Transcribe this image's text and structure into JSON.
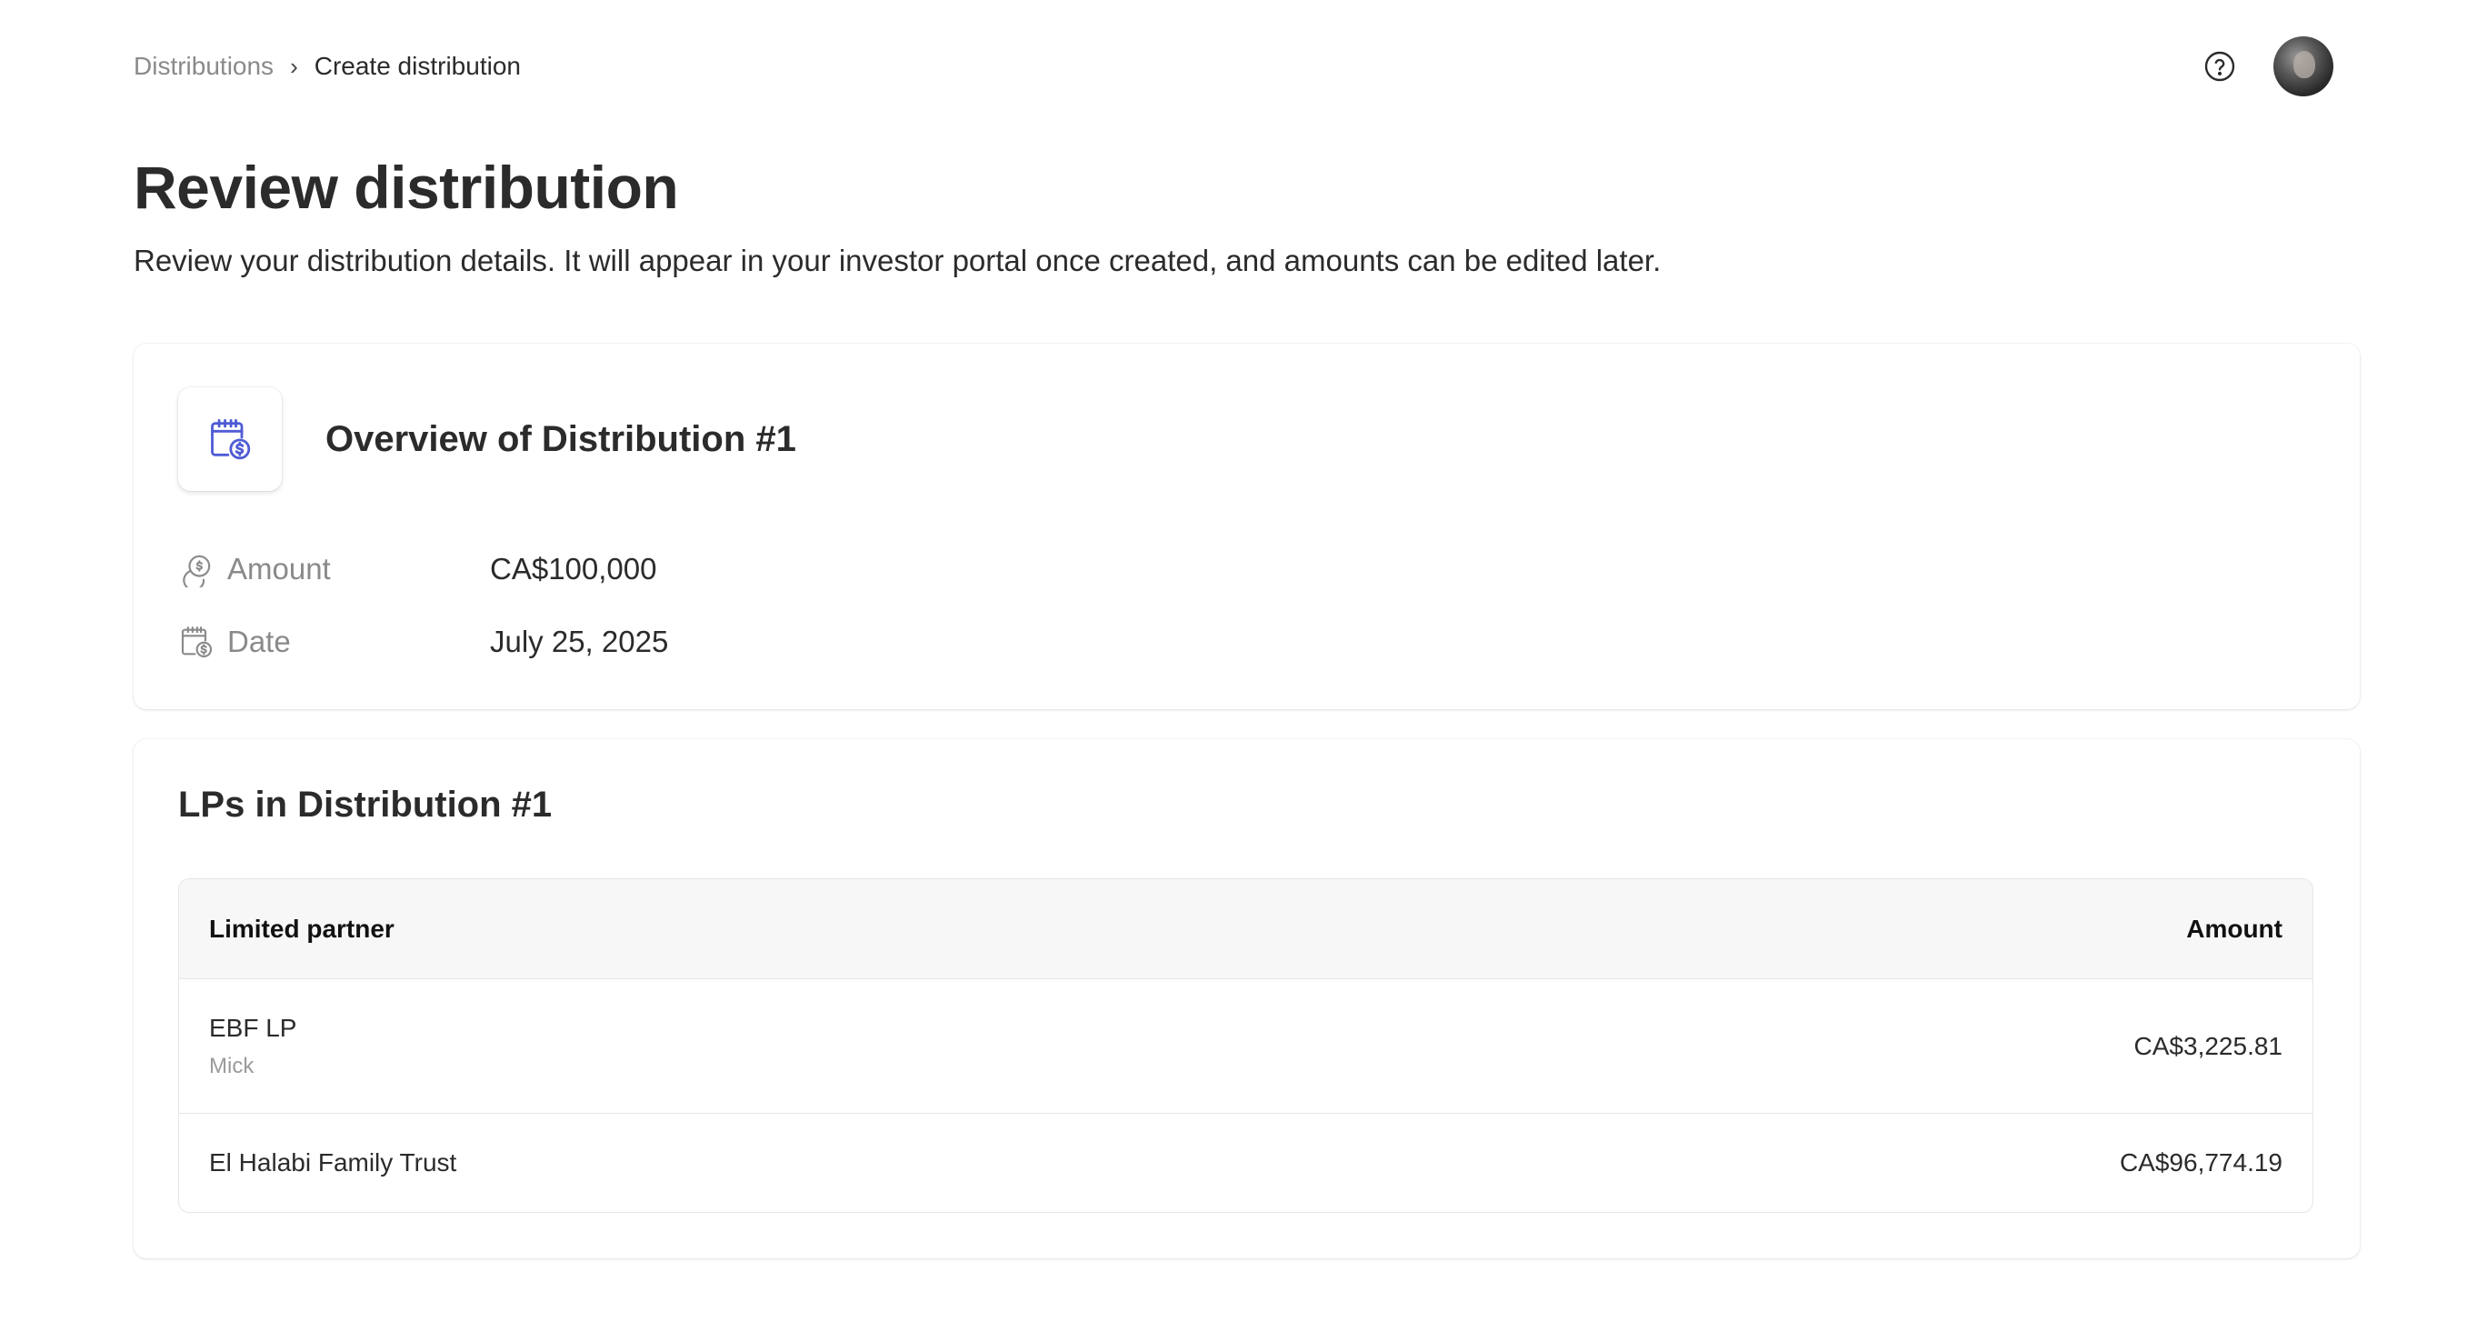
{
  "breadcrumb": {
    "parent": "Distributions",
    "separator": "›",
    "current": "Create distribution"
  },
  "header": {
    "help_icon": "question-circle-icon",
    "avatar": "user-avatar"
  },
  "page": {
    "title": "Review distribution",
    "subtitle": "Review your distribution details. It will appear in your investor portal once created, and amounts can be edited later."
  },
  "overview": {
    "icon": "calendar-dollar-icon",
    "title": "Overview of Distribution #1",
    "rows": [
      {
        "icon": "coins-icon",
        "label": "Amount",
        "value": "CA$100,000"
      },
      {
        "icon": "calendar-dollar-icon",
        "label": "Date",
        "value": "July 25, 2025"
      }
    ]
  },
  "lps": {
    "title": "LPs in Distribution #1",
    "columns": [
      "Limited partner",
      "Amount"
    ],
    "rows": [
      {
        "name": "EBF LP",
        "sub": "Mick",
        "amount": "CA$3,225.81"
      },
      {
        "name": "El Halabi Family Trust",
        "sub": "",
        "amount": "CA$96,774.19"
      }
    ]
  },
  "colors": {
    "accent_icon": "#4f5bd5",
    "text": "#2b2b2b",
    "muted": "#8a8a8a"
  }
}
